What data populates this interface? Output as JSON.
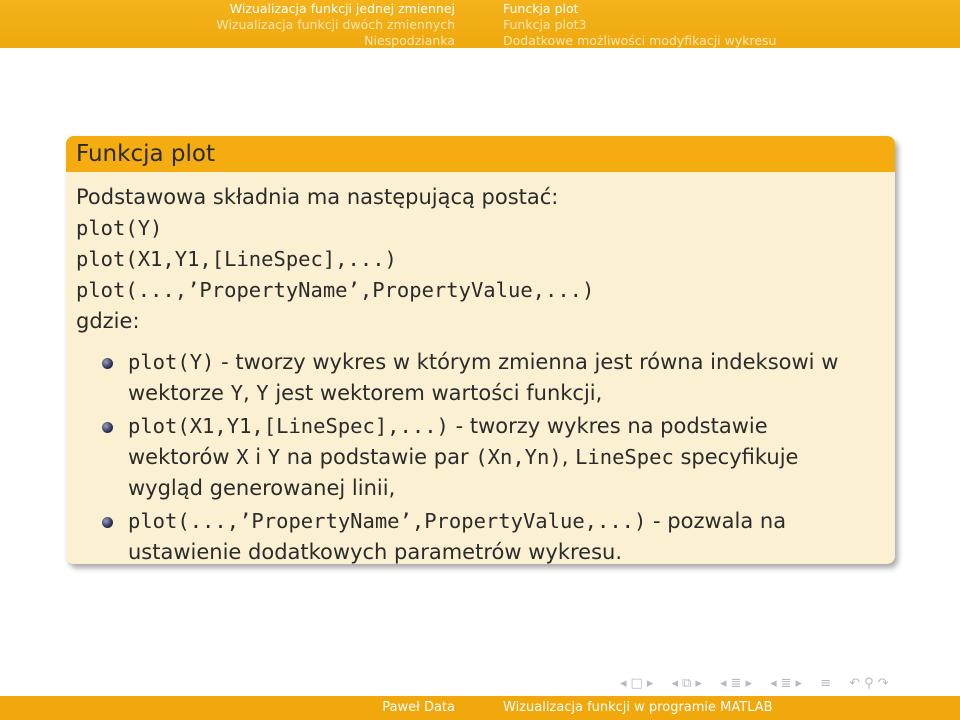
{
  "nav": {
    "left_items": [
      "Wizualizacja funkcji jednej zmiennej",
      "Wizualizacja funkcji dwóch zmiennych",
      "Niespodzianka"
    ],
    "right_items": [
      "Funckja plot",
      "Funkcja plot3",
      "Dodatkowe możliwości modyfikacji wykresu"
    ]
  },
  "block": {
    "title": "Funkcja plot",
    "intro": "Podstawowa składnia ma następującą postać:",
    "syntax": [
      "plot(Y)",
      "plot(X1,Y1,[LineSpec],...)",
      "plot(...,’PropertyName’,PropertyValue,...)"
    ],
    "where_label": "gdzie:",
    "items": [
      {
        "p1_code": "plot(Y)",
        "p1_text": " - tworzy wykres w którym zmienna jest równa indeksowi w",
        "p2_text": "wektorze ",
        "p2_code": "Y",
        "p2_text2": ", ",
        "p2_code2": "Y",
        "p2_text3": " jest wektorem wartości funkcji,"
      },
      {
        "p1_code": "plot(X1,Y1,[LineSpec],...)",
        "p1_text": " - tworzy wykres na podstawie",
        "p2_text": "wektorów ",
        "p2_code": "X",
        "p2_text2": " i ",
        "p2_code2": "Y",
        "p2_text3": " na podstawie par ",
        "p2_code3": "(Xn,Yn)",
        "p2_text4": ", ",
        "p2_code4": "LineSpec",
        "p2_text5": " specyfikuje",
        "p3_text": "wygląd generowanej linii,"
      },
      {
        "p1_code": "plot(...,’PropertyName’,PropertyValue,...)",
        "p1_text": " - pozwala na",
        "p2_text": "ustawienie dodatkowych parametrów wykresu."
      }
    ]
  },
  "footer": {
    "author": "Paweł Data",
    "title": "Wizualizacja funkcji w programie MATLAB"
  },
  "colors": {
    "bar": "#f0a80c",
    "block_title": "#f5ac10",
    "block_body": "#fcf0d3",
    "bullet": "#2c3256"
  }
}
